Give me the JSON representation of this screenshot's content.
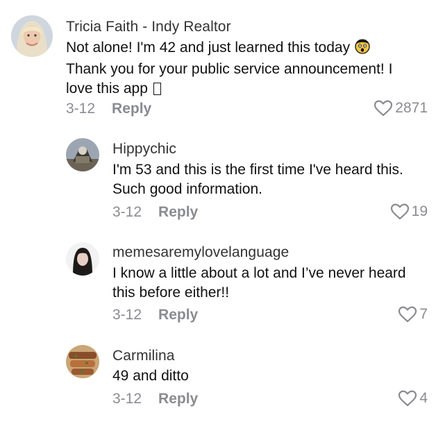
{
  "comments": [
    {
      "username": "Tricia Faith - Indy Realtor",
      "lines": [
        "Not alone! I'm 42 and just learned this today",
        "Thank you for your public service announcement! I",
        "love this app"
      ],
      "emoji": "shocked-face-emoji",
      "trailing_glyph": "missing-glyph-box",
      "date": "3-12",
      "reply_label": "Reply",
      "likes": "2871"
    },
    {
      "username": "Hippychic",
      "lines": [
        "I'm 53 and this is the first time I've heard this.",
        "Such good information."
      ],
      "date": "3-12",
      "reply_label": "Reply",
      "likes": "19"
    },
    {
      "username": "memesaremylovelanguage",
      "lines": [
        "I know a little about a lot and I’ve never heard",
        "this before either!!"
      ],
      "date": "3-12",
      "reply_label": "Reply",
      "likes": "7"
    },
    {
      "username": "Carmilina",
      "lines": [
        "49 and ditto"
      ],
      "date": "3-12",
      "reply_label": "Reply",
      "likes": "4"
    }
  ],
  "colors": {
    "text": "#111111",
    "username": "#333333",
    "muted": "#8a8b91",
    "background": "#ffffff"
  },
  "icons": {
    "like": "heart-outline-icon"
  }
}
